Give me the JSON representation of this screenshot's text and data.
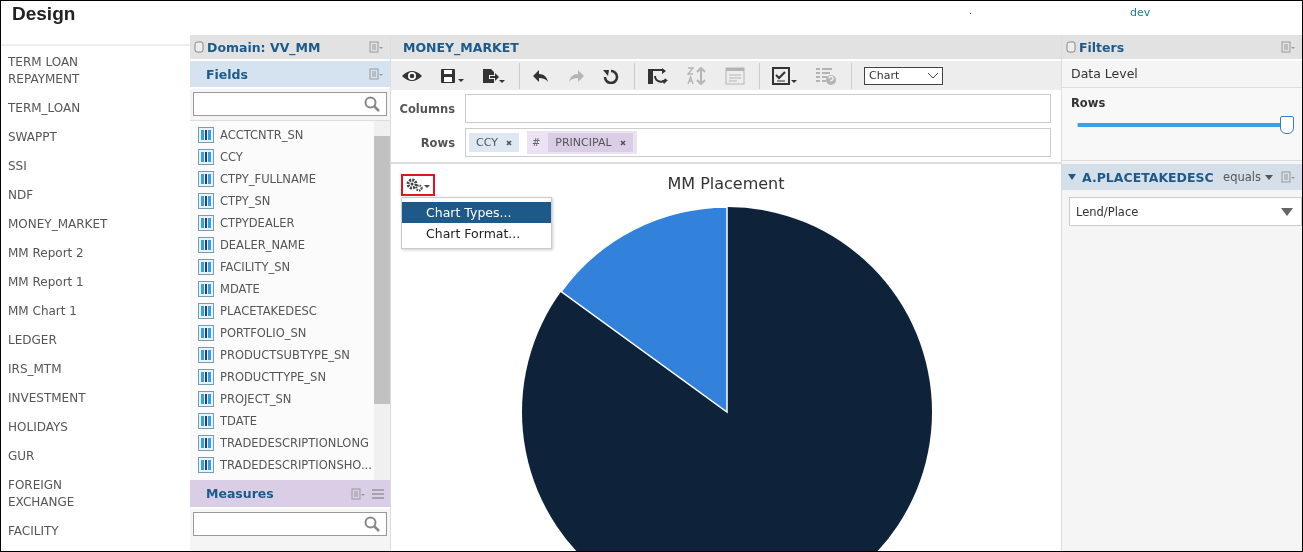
{
  "header": {
    "title": "Design",
    "dot": ".",
    "env": "dev"
  },
  "sidebar": {
    "items": [
      "TERM LOAN REPAYMENT",
      "TERM_LOAN",
      "SWAPPT",
      "SSI",
      "NDF",
      "MONEY_MARKET",
      "MM Report 2",
      "MM Report 1",
      "MM Chart 1",
      "LEDGER",
      "IRS_MTM",
      "INVESTMENT",
      "HOLIDAYS",
      "GUR",
      "FOREIGN EXCHANGE",
      "FACILITY"
    ]
  },
  "domain_panel": {
    "title": "Domain: VV_MM",
    "fields_title": "Fields",
    "fields": [
      "ACCTCNTR_SN",
      "CCY",
      "CTPY_FULLNAME",
      "CTPY_SN",
      "CTPYDEALER",
      "DEALER_NAME",
      "FACILITY_SN",
      "MDATE",
      "PLACETAKEDESC",
      "PORTFOLIO_SN",
      "PRODUCTSUBTYPE_SN",
      "PRODUCTTYPE_SN",
      "PROJECT_SN",
      "TDATE",
      "TRADEDESCRIPTIONLONG",
      "TRADEDESCRIPTIONSHO..."
    ],
    "measures_title": "Measures"
  },
  "report": {
    "title": "MONEY_MARKET",
    "toolbar": [
      [
        {
          "kind": "eye",
          "disabled": false
        },
        {
          "kind": "save",
          "disabled": false
        },
        {
          "kind": "export",
          "disabled": false
        }
      ],
      [
        {
          "kind": "undo",
          "disabled": false
        },
        {
          "kind": "redo",
          "disabled": true
        },
        {
          "kind": "refresh",
          "disabled": false
        }
      ],
      [
        {
          "kind": "swap",
          "disabled": false
        },
        {
          "kind": "sort",
          "disabled": true
        },
        {
          "kind": "table",
          "disabled": true
        }
      ],
      [
        {
          "kind": "checklist",
          "disabled": false
        },
        {
          "kind": "help",
          "disabled": true
        }
      ]
    ],
    "view_select": "Chart",
    "columns_label": "Columns",
    "rows_label": "Rows",
    "row_chips": [
      {
        "label": "CCY",
        "kind": "dimension"
      },
      {
        "label": "PRINCIPAL",
        "kind": "measure",
        "prefix": "#"
      }
    ],
    "chart_title": "MM Placement",
    "menu": [
      {
        "label": "Chart Types...",
        "selected": true
      },
      {
        "label": "Chart Format...",
        "selected": false
      }
    ]
  },
  "filters": {
    "title": "Filters",
    "data_level": "Data Level",
    "rows_label": "Rows",
    "slider": {
      "level": 1
    },
    "filter": {
      "field": "A.PLACETAKEDESC",
      "operator": "equals",
      "value": "Lend/Place",
      "expanded": true
    }
  }
}
